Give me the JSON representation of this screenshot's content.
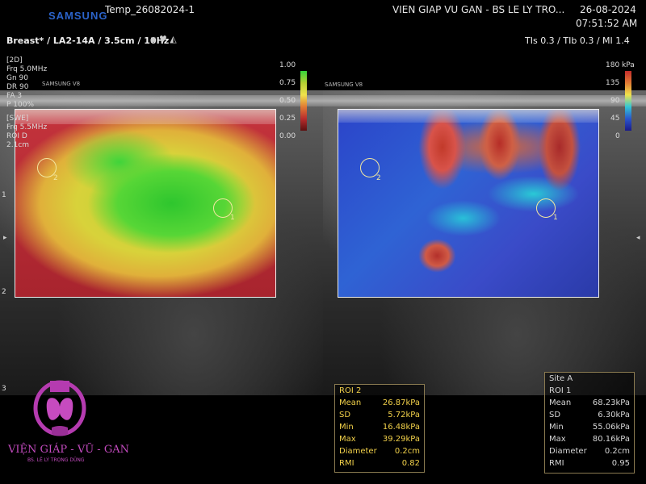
{
  "header": {
    "brand": "SAMSUNG",
    "patient_id": "Temp_26082024-1",
    "institution": "VIEN GIAP VU GAN - BS LE LY TRO...",
    "date": "26-08-2024",
    "time": "07:51:52 AM",
    "preset": "Breast* / LA2-14A / 3.5cm / 10Hz",
    "tis": "TIs  0.3 / TIb  0.3 / MI    1.4"
  },
  "params_2d": [
    "[2D]",
    "Frq  5.0MHz",
    "Gn   90",
    "DR   90",
    "FA   3",
    "P    100%"
  ],
  "params_swe": [
    "[SWE]",
    "Frq  5.5MHz",
    "ROI D",
    "    2.1cm"
  ],
  "left_scale": {
    "labels": [
      "1.00",
      "0.75",
      "0.50",
      "0.25",
      "0.00"
    ]
  },
  "right_scale": {
    "labels": [
      "180 kPa",
      "135",
      "90",
      "45",
      "0"
    ]
  },
  "watermark": {
    "left": "SAMSUNG V8",
    "right": "SAMSUNG V8"
  },
  "roi_markers": {
    "left_1": "1",
    "left_2": "2",
    "right_1": "1",
    "right_2": "2"
  },
  "roi2": {
    "title": "ROI 2",
    "rows": [
      {
        "label": "Mean",
        "value": "26.87kPa"
      },
      {
        "label": "SD",
        "value": "5.72kPa"
      },
      {
        "label": "Min",
        "value": "16.48kPa"
      },
      {
        "label": "Max",
        "value": "39.29kPa"
      },
      {
        "label": "Diameter",
        "value": "0.2cm"
      },
      {
        "label": "RMI",
        "value": "0.82"
      }
    ]
  },
  "roi1": {
    "site": "Site A",
    "title": "ROI 1",
    "rows": [
      {
        "label": "Mean",
        "value": "68.23kPa"
      },
      {
        "label": "SD",
        "value": "6.30kPa"
      },
      {
        "label": "Min",
        "value": "55.06kPa"
      },
      {
        "label": "Max",
        "value": "80.16kPa"
      },
      {
        "label": "Diameter",
        "value": "0.2cm"
      },
      {
        "label": "RMI",
        "value": "0.95"
      }
    ]
  },
  "logo": {
    "name": "VIỆN GIÁP - VŨ - GAN",
    "doctor": "BS. LÊ LÝ TRỌNG DŨNG"
  },
  "depth_marks": [
    "1",
    "2",
    "3"
  ],
  "colors": {
    "accent": "#f2d14a",
    "brand": "#2b63c9",
    "logo": "#b53bb0"
  }
}
